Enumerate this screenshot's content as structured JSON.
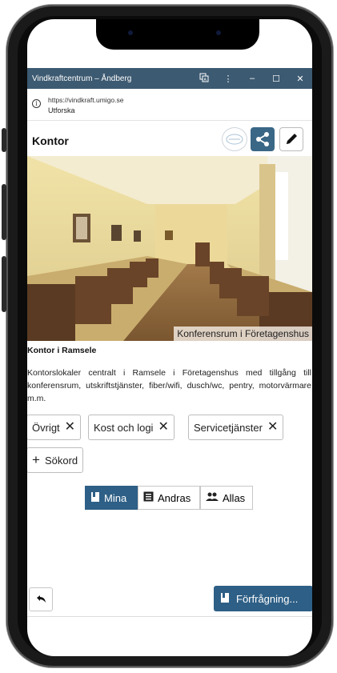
{
  "window": {
    "title": "Vindkraftcentrum – Åndberg",
    "icons": [
      "translate-icon",
      "more-vert-icon",
      "minimize-icon",
      "maximize-icon",
      "close-icon"
    ]
  },
  "urlbar": {
    "url": "https://vindkraft.umigo.se",
    "subtitle": "Utforska"
  },
  "header": {
    "title": "Kontor"
  },
  "photo": {
    "caption": "Konferensrum i Företagenshus"
  },
  "content": {
    "subheading": "Kontor i Ramsele",
    "description": "Kontorslokaler centralt i Ramsele i Företagenshus med tillgång till konferensrum, utskriftstjänster, fiber/wifi, dusch/wc, pentry, motorvärmare m.m."
  },
  "tags": [
    "Övrigt",
    "Kost och logi",
    "Servicetjänster"
  ],
  "add_keyword": "Sökord",
  "view_tabs": [
    {
      "label": "Mina",
      "icon": "bookmark-icon",
      "active": true
    },
    {
      "label": "Andras",
      "icon": "list-icon",
      "active": false
    },
    {
      "label": "Allas",
      "icon": "people-icon",
      "active": false
    }
  ],
  "footer": {
    "request_label": "Förfrågning..."
  },
  "colors": {
    "titlebar": "#3c5a71",
    "accent": "#2e5f86"
  }
}
